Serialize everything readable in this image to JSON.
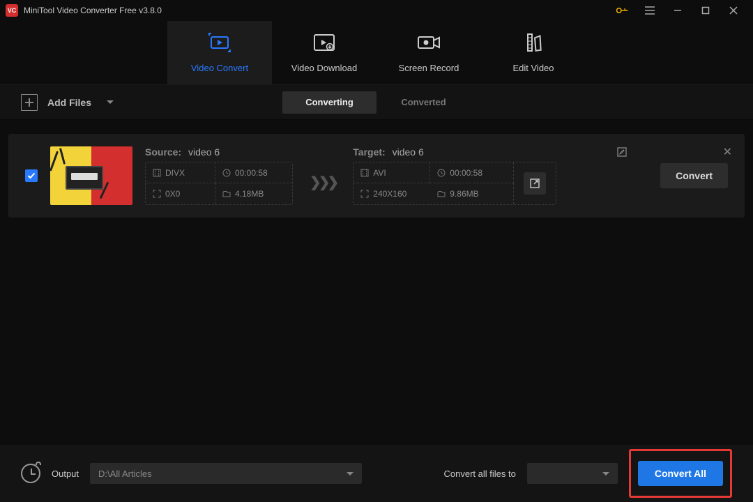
{
  "titlebar": {
    "app_name": "MiniTool Video Converter Free v3.8.0"
  },
  "main_tabs": {
    "convert": "Video Convert",
    "download": "Video Download",
    "record": "Screen Record",
    "edit": "Edit Video"
  },
  "toolbar": {
    "add_files": "Add Files",
    "sub_converting": "Converting",
    "sub_converted": "Converted"
  },
  "file": {
    "source_label": "Source:",
    "source_name": "video 6",
    "source_format": "DIVX",
    "source_duration": "00:00:58",
    "source_dimensions": "0X0",
    "source_size": "4.18MB",
    "target_label": "Target:",
    "target_name": "video 6",
    "target_format": "AVI",
    "target_duration": "00:00:58",
    "target_dimensions": "240X160",
    "target_size": "9.86MB",
    "convert_btn": "Convert"
  },
  "footer": {
    "output_label": "Output",
    "output_path": "D:\\All Articles",
    "convert_to_label": "Convert all files to",
    "convert_all": "Convert All"
  }
}
